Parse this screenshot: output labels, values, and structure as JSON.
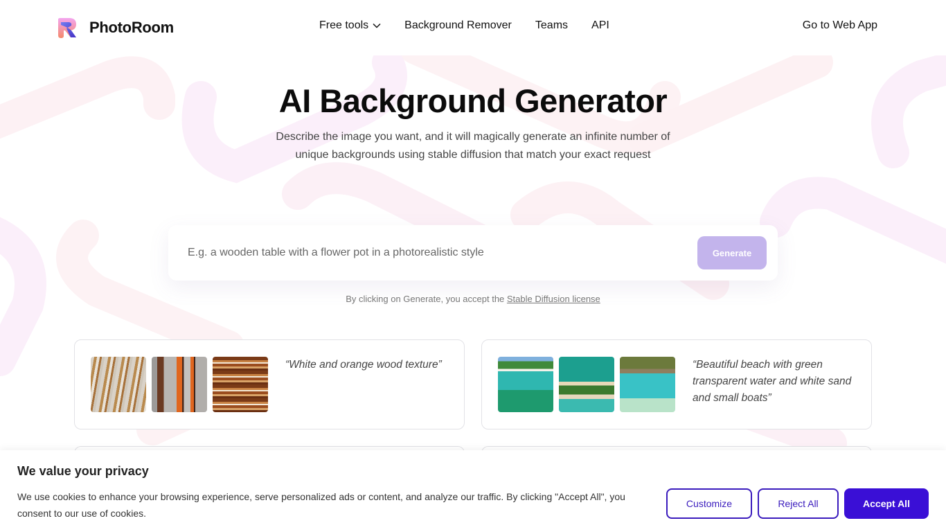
{
  "header": {
    "brand": "PhotoRoom",
    "nav": [
      {
        "label": "Free tools",
        "has_dropdown": true
      },
      {
        "label": "Background Remover"
      },
      {
        "label": "Teams"
      },
      {
        "label": "API"
      }
    ],
    "web_app_label": "Go to Web App"
  },
  "hero": {
    "title": "AI Background Generator",
    "subtitle": "Describe the image you want, and it will magically generate an infinite number of unique backgrounds using stable diffusion that match your exact request",
    "prompt": {
      "value": "",
      "placeholder": "E.g. a wooden table with a flower pot in a photorealistic style"
    },
    "generate_label": "Generate",
    "license_prefix": "By clicking on Generate, you accept the ",
    "license_link": "Stable Diffusion license"
  },
  "examples": [
    {
      "quote": "“White and orange wood texture”",
      "thumbnails": [
        "wood-texture-1",
        "wood-texture-2",
        "wood-texture-3"
      ]
    },
    {
      "quote": "“Beautiful beach with green transparent water and white sand and small boats”",
      "thumbnails": [
        "beach-1",
        "beach-2",
        "beach-3"
      ]
    }
  ],
  "cookie_banner": {
    "title": "We value your privacy",
    "text": "We use cookies to enhance your browsing experience, serve personalized ads or content, and analyze our traffic. By clicking \"Accept All\", you consent to our use of cookies.",
    "customize_label": "Customize",
    "reject_label": "Reject All",
    "accept_label": "Accept All"
  },
  "colors": {
    "accent": "#3a0fd6",
    "generate_disabled": "#c3b4ec",
    "background_pattern": "#fbeff6"
  }
}
